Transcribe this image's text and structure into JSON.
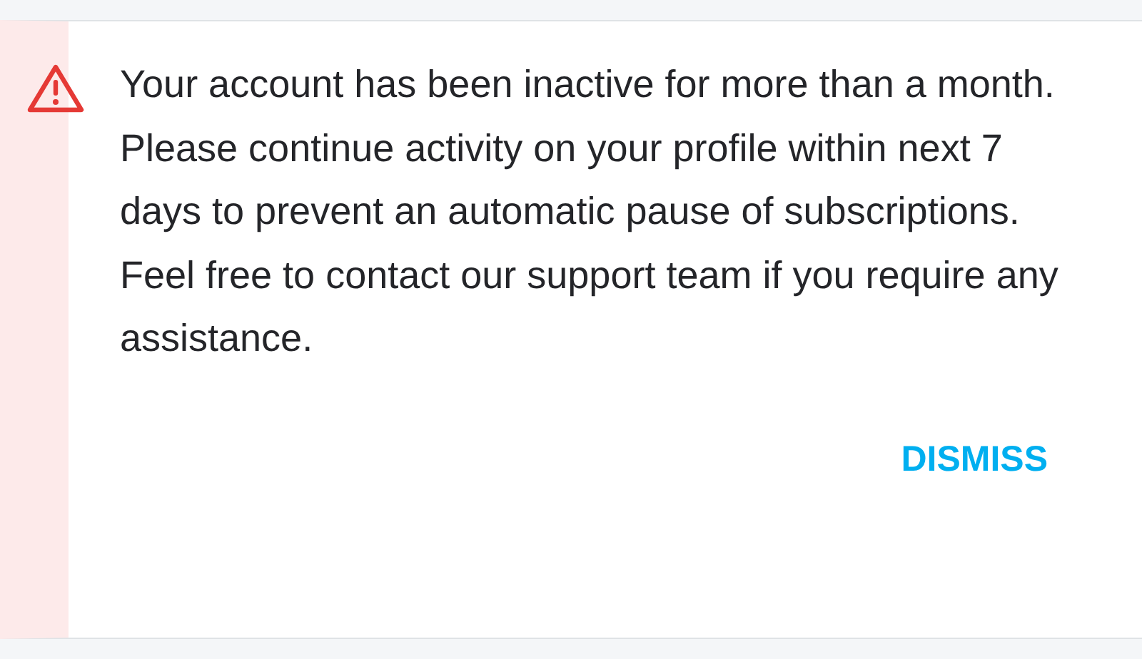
{
  "alert": {
    "kind": "warning",
    "message": "Your account has been inactive for more than a month. Please continue activity on your profile within next 7 days to prevent an automatic pause of subscriptions. Feel free to contact our support team if you require any assistance.",
    "action": "DISMISS"
  }
}
